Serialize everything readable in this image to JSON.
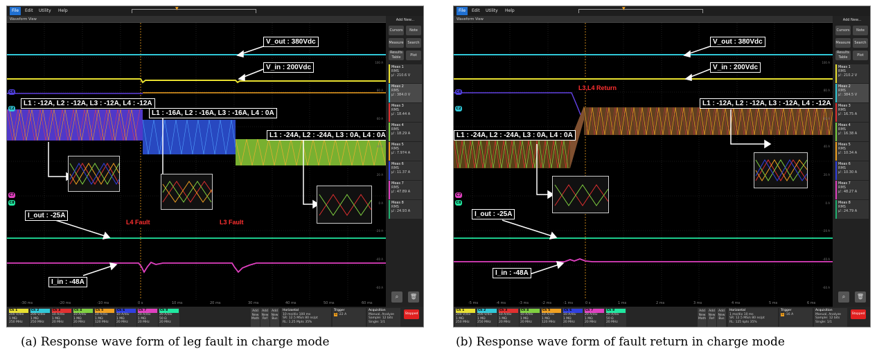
{
  "menu": {
    "file": "File",
    "edit": "Edit",
    "utility": "Utility",
    "help": "Help"
  },
  "window_title": "Waveform View",
  "side": {
    "add_new": "Add New...",
    "cursors": "Cursors",
    "note": "Note",
    "measure": "Measure",
    "search": "Search",
    "results_table": "Results Table",
    "plot": "Plot",
    "rms": "RMS",
    "meas_labels": [
      "Meas 1",
      "Meas 2",
      "Meas 3",
      "Meas 4",
      "Meas 5",
      "Meas 6",
      "Meas 7",
      "Meas 8"
    ],
    "meas_colors": [
      "#e8e030",
      "#30c8d8",
      "#e03030",
      "#80d040",
      "#f0a020",
      "#3040e0",
      "#e040c0",
      "#20b070"
    ]
  },
  "bottom": {
    "channels": [
      {
        "name": "Ch 1",
        "vdiv": "200 V/div",
        "imp": "1 MΩ",
        "bw": "250 MHz",
        "color": "#e8e030"
      },
      {
        "name": "Ch 2",
        "vdiv": "200 V/div",
        "imp": "1 MΩ",
        "bw": "250 MHz",
        "color": "#30c8d8"
      },
      {
        "name": "Ch 3",
        "vdiv": "10 A/div",
        "imp": "1 MΩ",
        "bw": "20 MHz",
        "color": "#e03030"
      },
      {
        "name": "Ch 4",
        "vdiv": "10 A/div",
        "imp": "1 MΩ",
        "bw": "20 MHz",
        "color": "#80d040"
      },
      {
        "name": "Ch 5",
        "vdiv": "10 A/div",
        "imp": "1 MΩ",
        "bw": "120 MHz",
        "color": "#f0a020"
      },
      {
        "name": "Ch 6",
        "vdiv": "10 A/div",
        "imp": "1 MΩ",
        "bw": "20 MHz",
        "color": "#3040e0"
      },
      {
        "name": "Ch 7",
        "vdiv": "20 A/div",
        "imp": "1 MΩ",
        "bw": "20 MHz",
        "color": "#e040c0"
      },
      {
        "name": "Ch 8",
        "vdiv": "20 A/div",
        "imp": "50 Ω",
        "bw": "20 MHz",
        "color": "#20e8a0"
      }
    ],
    "add_new_math": "Add New Math",
    "add_new_ref": "Add New Ref",
    "add_new_bus": "Add New Bus",
    "horizontal_title": "Horizontal",
    "trigger_title": "Trigger",
    "acquisition_title": "Acquisition",
    "acq_mode": "Manual, Analyze",
    "acq_sample": "Sample: 12 bits",
    "acq_single": "Single: 1/1",
    "stopped": "Stopped"
  },
  "scope_a": {
    "labels": {
      "vout": "V_out : 380Vdc",
      "vin": "V_in : 200Vdc",
      "l_all12": "L1 : -12A, L2 : -12A, L3 : -12A, L4 : -12A",
      "l_16": "L1 : -16A, L2 : -16A, L3 : -16A, L4 : 0A",
      "l_24": "L1 : -24A, L2 : -24A, L3 : 0A, L4 : 0A",
      "iout": "I_out : -25A",
      "iin": "I_in : -48A",
      "fault4": "L4 Fault",
      "fault3": "L3 Fault"
    },
    "time_ticks": [
      "-30 ms",
      "-20 ms",
      "-10 ms",
      "0 s",
      "10 ms",
      "20 ms",
      "30 ms",
      "40 ms",
      "50 ms",
      "60 ms"
    ],
    "scale_ticks": [
      "100 A",
      "80 A",
      "60 A",
      "40 A",
      "20 A",
      "0 A",
      "-20 A",
      "-40 A",
      "-60 A"
    ],
    "meas_values": [
      "μ': 210.6 V",
      "μ': 384.0 V",
      "μ': 18.44 A",
      "μ': 18.29 A",
      "μ': 7.974 A",
      "μ': 11.37 A",
      "μ': 47.89 A",
      "μ': 24.93 A"
    ],
    "horizontal": {
      "scale": "10 ms/div",
      "sr": "SR: 12.5 MS/s",
      "rl": "RL: 1.25 Mpts",
      "len": "100 ms",
      "pt": "80 ns/pt",
      "pct": "35%"
    },
    "trigger": {
      "ch": "5",
      "level": "-22 A"
    },
    "caption": "(a) Response wave form of leg fault in charge mode"
  },
  "scope_b": {
    "labels": {
      "vout": "V_out : 380Vdc",
      "vin": "V_in : 200Vdc",
      "l_24": "L1 : -24A, L2 : -24A, L3 : 0A, L4 : 0A",
      "l_all12": "L1 : -12A, L2 : -12A, L3 : -12A, L4 : -12A",
      "return": "L3,L4 Return",
      "iout": "I_out : -25A",
      "iin": "I_in : -48A"
    },
    "time_ticks": [
      "-5 ms",
      "-4 ms",
      "-3 ms",
      "-2 ms",
      "-1 ms",
      "0 s",
      "1 ms",
      "2 ms",
      "3 ms",
      "4 ms",
      "5 ms",
      "6 ms"
    ],
    "scale_ticks": [
      "100 A",
      "80 A",
      "60 A",
      "40 A",
      "20 A",
      "0 A",
      "-20 A",
      "-40 A",
      "-60 A"
    ],
    "meas_values": [
      "μ': 210.2 V",
      "μ': 384.5 V",
      "μ': 16.75 A",
      "μ': 16.38 A",
      "μ': 10.34 A",
      "μ': 10.30 A",
      "μ': 48.27 A",
      "μ': 24.79 A"
    ],
    "horizontal": {
      "scale": "1 ms/div",
      "sr": "SR: 12.5 MS/s",
      "rl": "RL: 125 kpts",
      "len": "10 ms",
      "pt": "80 ns/pt",
      "pct": "35%"
    },
    "trigger": {
      "ch": "5",
      "level": "-16 A"
    },
    "caption": "(b) Response wave form of fault return in charge mode"
  }
}
